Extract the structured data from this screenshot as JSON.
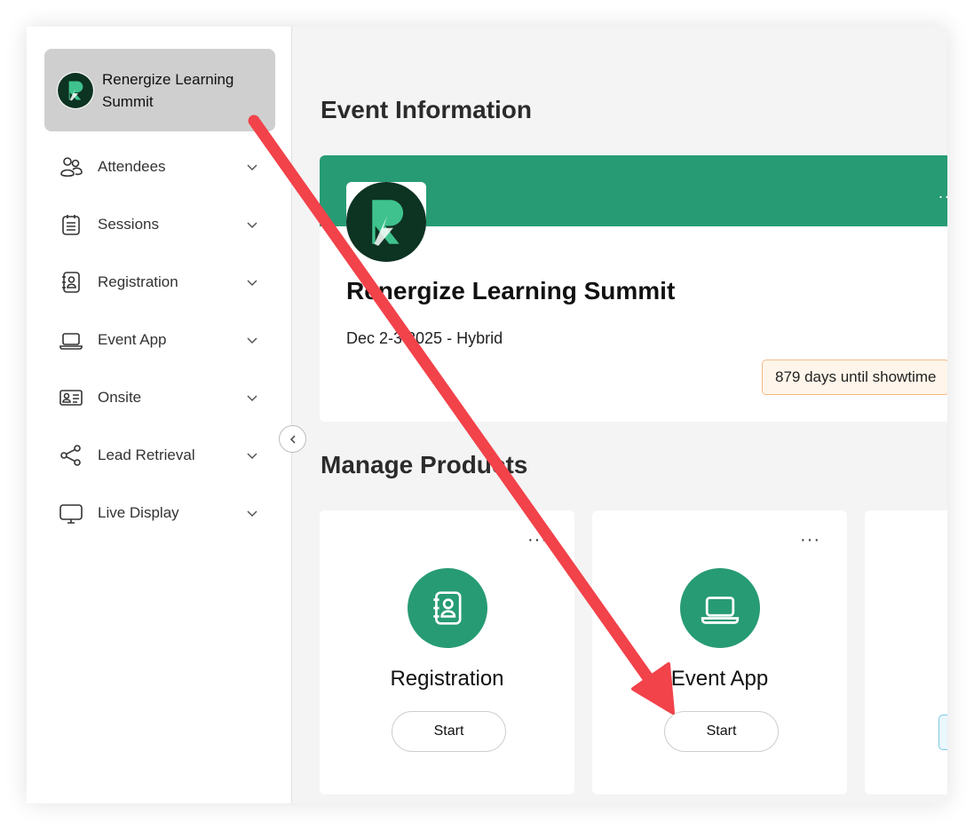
{
  "sidebar": {
    "event_name": "Renergize Learning Summit",
    "items": [
      {
        "label": "Attendees"
      },
      {
        "label": "Sessions"
      },
      {
        "label": "Registration"
      },
      {
        "label": "Event App"
      },
      {
        "label": "Onsite"
      },
      {
        "label": "Lead Retrieval"
      },
      {
        "label": "Live Display"
      }
    ]
  },
  "event_info": {
    "section_title": "Event Information",
    "name": "Renergize Learning Summit",
    "date_line": "Dec 2-3 2025 - Hybrid",
    "countdown": "879 days until showtime",
    "banner_menu": "..."
  },
  "products": {
    "section_title": "Manage Products",
    "cards": [
      {
        "name": "Registration",
        "button": "Start",
        "menu": "···"
      },
      {
        "name": "Event App",
        "button": "Start",
        "menu": "···"
      }
    ]
  },
  "colors": {
    "brand_green": "#279b74",
    "logo_dark": "#0d3322",
    "annotation_arrow": "#f2424a",
    "countdown_bg": "#fff5ea"
  },
  "icons": [
    "logo-r-icon",
    "attendees-icon",
    "sessions-icon",
    "registration-icon",
    "laptop-icon",
    "badge-icon",
    "share-icon",
    "monitor-icon",
    "chevron-down-icon",
    "chevron-left-icon",
    "more-icon"
  ]
}
